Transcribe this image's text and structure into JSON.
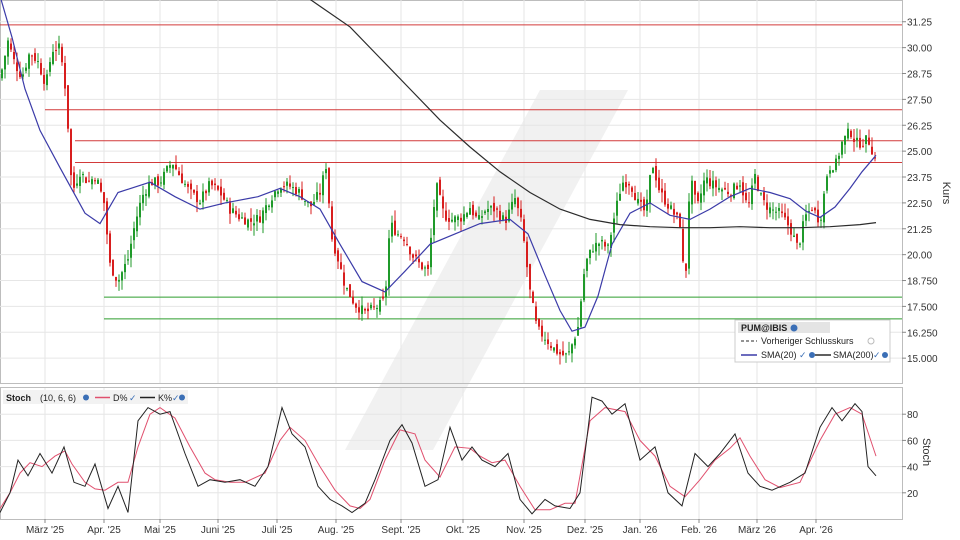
{
  "colors": {
    "candle_up": "#1f9a2a",
    "candle_down": "#d81e1e",
    "sma20": "#3b3ba8",
    "sma200": "#2b2b2b",
    "resistance": "#d23a3a",
    "support": "#2e9e2e",
    "stoch_d": "#e0506e",
    "stoch_k": "#222222",
    "grid": "#e6e6e6",
    "watermark": "#eeeeee"
  },
  "legend": {
    "symbol": "PUM@IBIS",
    "prev_close": "Vorheriger Schlusskurs",
    "sma20": "SMA(20)",
    "sma200": "SMA(200)"
  },
  "stoch_header": {
    "name": "Stoch",
    "params": "(10, 6, 6)",
    "d_label": "D%",
    "k_label": "K%"
  },
  "chart_data": [
    {
      "type": "candlestick",
      "ylabel": "Kurs",
      "ylim": [
        13.8,
        32.3
      ],
      "y_ticks": [
        "31.25",
        "30.00",
        "28.75",
        "27.50",
        "26.25",
        "25.00",
        "23.75",
        "22.50",
        "21.25",
        "20.00",
        "18.750",
        "17.500",
        "16.250",
        "15.000"
      ],
      "x_ticks": [
        "März '25",
        "Apr. '25",
        "Mai '25",
        "Juni '25",
        "Juli '25",
        "Aug. '25",
        "Sept. '25",
        "Okt. '25",
        "Nov. '25",
        "Dez. '25",
        "Jan. '26",
        "Feb. '26",
        "März '26",
        "Apr. '26"
      ],
      "resistance_levels": [
        31.1,
        27.0,
        25.5,
        24.45
      ],
      "support_levels": [
        17.95,
        16.9
      ],
      "series": [
        {
          "name": "SMA(20)",
          "points": [
            [
              0,
              32.5
            ],
            [
              12,
              30.5
            ],
            [
              25,
              28.0
            ],
            [
              40,
              26.0
            ],
            [
              60,
              24.2
            ],
            [
              85,
              22.0
            ],
            [
              100,
              21.5
            ],
            [
              118,
              23.0
            ],
            [
              150,
              23.5
            ],
            [
              175,
              22.8
            ],
            [
              200,
              22.2
            ],
            [
              225,
              22.5
            ],
            [
              258,
              22.8
            ],
            [
              280,
              23.2
            ],
            [
              300,
              22.8
            ],
            [
              320,
              22.2
            ],
            [
              340,
              20.5
            ],
            [
              362,
              18.7
            ],
            [
              385,
              18.2
            ],
            [
              405,
              19.2
            ],
            [
              430,
              20.5
            ],
            [
              455,
              21.0
            ],
            [
              480,
              21.5
            ],
            [
              510,
              21.7
            ],
            [
              528,
              21.0
            ],
            [
              545,
              19.0
            ],
            [
              560,
              17.3
            ],
            [
              572,
              16.3
            ],
            [
              585,
              16.5
            ],
            [
              598,
              18.0
            ],
            [
              612,
              20.5
            ],
            [
              630,
              22.0
            ],
            [
              650,
              22.5
            ],
            [
              670,
              21.9
            ],
            [
              690,
              21.7
            ],
            [
              710,
              22.2
            ],
            [
              730,
              22.8
            ],
            [
              750,
              23.2
            ],
            [
              770,
              23.0
            ],
            [
              790,
              22.7
            ],
            [
              806,
              22.1
            ],
            [
              820,
              21.8
            ],
            [
              835,
              22.3
            ],
            [
              850,
              23.2
            ],
            [
              862,
              24.0
            ],
            [
              876,
              24.8
            ]
          ]
        },
        {
          "name": "SMA(200)",
          "points": [
            [
              290,
              33.0
            ],
            [
              320,
              32.0
            ],
            [
              350,
              31.0
            ],
            [
              380,
              29.5
            ],
            [
              410,
              28.0
            ],
            [
              440,
              26.5
            ],
            [
              470,
              25.2
            ],
            [
              500,
              24.0
            ],
            [
              530,
              23.0
            ],
            [
              560,
              22.2
            ],
            [
              590,
              21.7
            ],
            [
              620,
              21.45
            ],
            [
              650,
              21.35
            ],
            [
              680,
              21.3
            ],
            [
              710,
              21.3
            ],
            [
              740,
              21.35
            ],
            [
              770,
              21.3
            ],
            [
              800,
              21.3
            ],
            [
              830,
              21.35
            ],
            [
              860,
              21.45
            ],
            [
              876,
              21.55
            ]
          ]
        }
      ]
    },
    {
      "type": "line",
      "ylabel": "Stoch",
      "ylim": [
        0,
        100
      ],
      "y_ticks": [
        "80",
        "60",
        "40",
        "20"
      ],
      "series": [
        {
          "name": "D%",
          "points": [
            [
              0,
              8
            ],
            [
              10,
              20
            ],
            [
              20,
              35
            ],
            [
              30,
              43
            ],
            [
              42,
              40
            ],
            [
              55,
              48
            ],
            [
              65,
              52
            ],
            [
              72,
              42
            ],
            [
              85,
              28
            ],
            [
              95,
              23
            ],
            [
              105,
              22
            ],
            [
              118,
              28
            ],
            [
              128,
              28
            ],
            [
              138,
              55
            ],
            [
              150,
              80
            ],
            [
              160,
              85
            ],
            [
              175,
              77
            ],
            [
              190,
              55
            ],
            [
              205,
              35
            ],
            [
              215,
              30
            ],
            [
              230,
              28
            ],
            [
              245,
              28
            ],
            [
              265,
              35
            ],
            [
              280,
              60
            ],
            [
              290,
              70
            ],
            [
              305,
              60
            ],
            [
              320,
              40
            ],
            [
              335,
              22
            ],
            [
              350,
              10
            ],
            [
              360,
              8
            ],
            [
              370,
              15
            ],
            [
              385,
              45
            ],
            [
              400,
              68
            ],
            [
              415,
              65
            ],
            [
              425,
              45
            ],
            [
              440,
              32
            ],
            [
              455,
              55
            ],
            [
              470,
              54
            ],
            [
              480,
              48
            ],
            [
              492,
              43
            ],
            [
              505,
              45
            ],
            [
              520,
              25
            ],
            [
              535,
              7
            ],
            [
              550,
              7
            ],
            [
              565,
              12
            ],
            [
              575,
              12
            ],
            [
              590,
              75
            ],
            [
              605,
              85
            ],
            [
              625,
              82
            ],
            [
              640,
              60
            ],
            [
              655,
              48
            ],
            [
              670,
              25
            ],
            [
              685,
              17
            ],
            [
              700,
              30
            ],
            [
              715,
              45
            ],
            [
              730,
              54
            ],
            [
              740,
              62
            ],
            [
              750,
              48
            ],
            [
              765,
              30
            ],
            [
              780,
              24
            ],
            [
              800,
              28
            ],
            [
              820,
              60
            ],
            [
              835,
              80
            ],
            [
              850,
              85
            ],
            [
              862,
              80
            ],
            [
              876,
              48
            ]
          ]
        },
        {
          "name": "K%",
          "points": [
            [
              0,
              5
            ],
            [
              10,
              20
            ],
            [
              18,
              45
            ],
            [
              28,
              33
            ],
            [
              40,
              50
            ],
            [
              52,
              35
            ],
            [
              64,
              55
            ],
            [
              74,
              28
            ],
            [
              85,
              25
            ],
            [
              95,
              42
            ],
            [
              108,
              8
            ],
            [
              118,
              25
            ],
            [
              128,
              5
            ],
            [
              138,
              75
            ],
            [
              148,
              85
            ],
            [
              160,
              80
            ],
            [
              170,
              82
            ],
            [
              185,
              50
            ],
            [
              198,
              25
            ],
            [
              210,
              30
            ],
            [
              225,
              28
            ],
            [
              240,
              30
            ],
            [
              255,
              25
            ],
            [
              268,
              40
            ],
            [
              282,
              85
            ],
            [
              292,
              65
            ],
            [
              305,
              55
            ],
            [
              318,
              25
            ],
            [
              330,
              15
            ],
            [
              342,
              10
            ],
            [
              352,
              5
            ],
            [
              365,
              12
            ],
            [
              375,
              30
            ],
            [
              390,
              60
            ],
            [
              402,
              72
            ],
            [
              412,
              58
            ],
            [
              425,
              25
            ],
            [
              438,
              30
            ],
            [
              450,
              70
            ],
            [
              462,
              45
            ],
            [
              472,
              55
            ],
            [
              482,
              45
            ],
            [
              495,
              40
            ],
            [
              508,
              50
            ],
            [
              520,
              15
            ],
            [
              532,
              4
            ],
            [
              545,
              15
            ],
            [
              555,
              10
            ],
            [
              570,
              8
            ],
            [
              580,
              20
            ],
            [
              592,
              93
            ],
            [
              602,
              90
            ],
            [
              612,
              80
            ],
            [
              625,
              88
            ],
            [
              640,
              45
            ],
            [
              655,
              55
            ],
            [
              668,
              20
            ],
            [
              682,
              10
            ],
            [
              695,
              50
            ],
            [
              708,
              40
            ],
            [
              720,
              50
            ],
            [
              735,
              65
            ],
            [
              748,
              35
            ],
            [
              760,
              25
            ],
            [
              772,
              22
            ],
            [
              790,
              28
            ],
            [
              805,
              35
            ],
            [
              820,
              70
            ],
            [
              832,
              85
            ],
            [
              842,
              75
            ],
            [
              855,
              88
            ],
            [
              862,
              82
            ],
            [
              868,
              40
            ],
            [
              876,
              33
            ]
          ]
        }
      ]
    }
  ]
}
